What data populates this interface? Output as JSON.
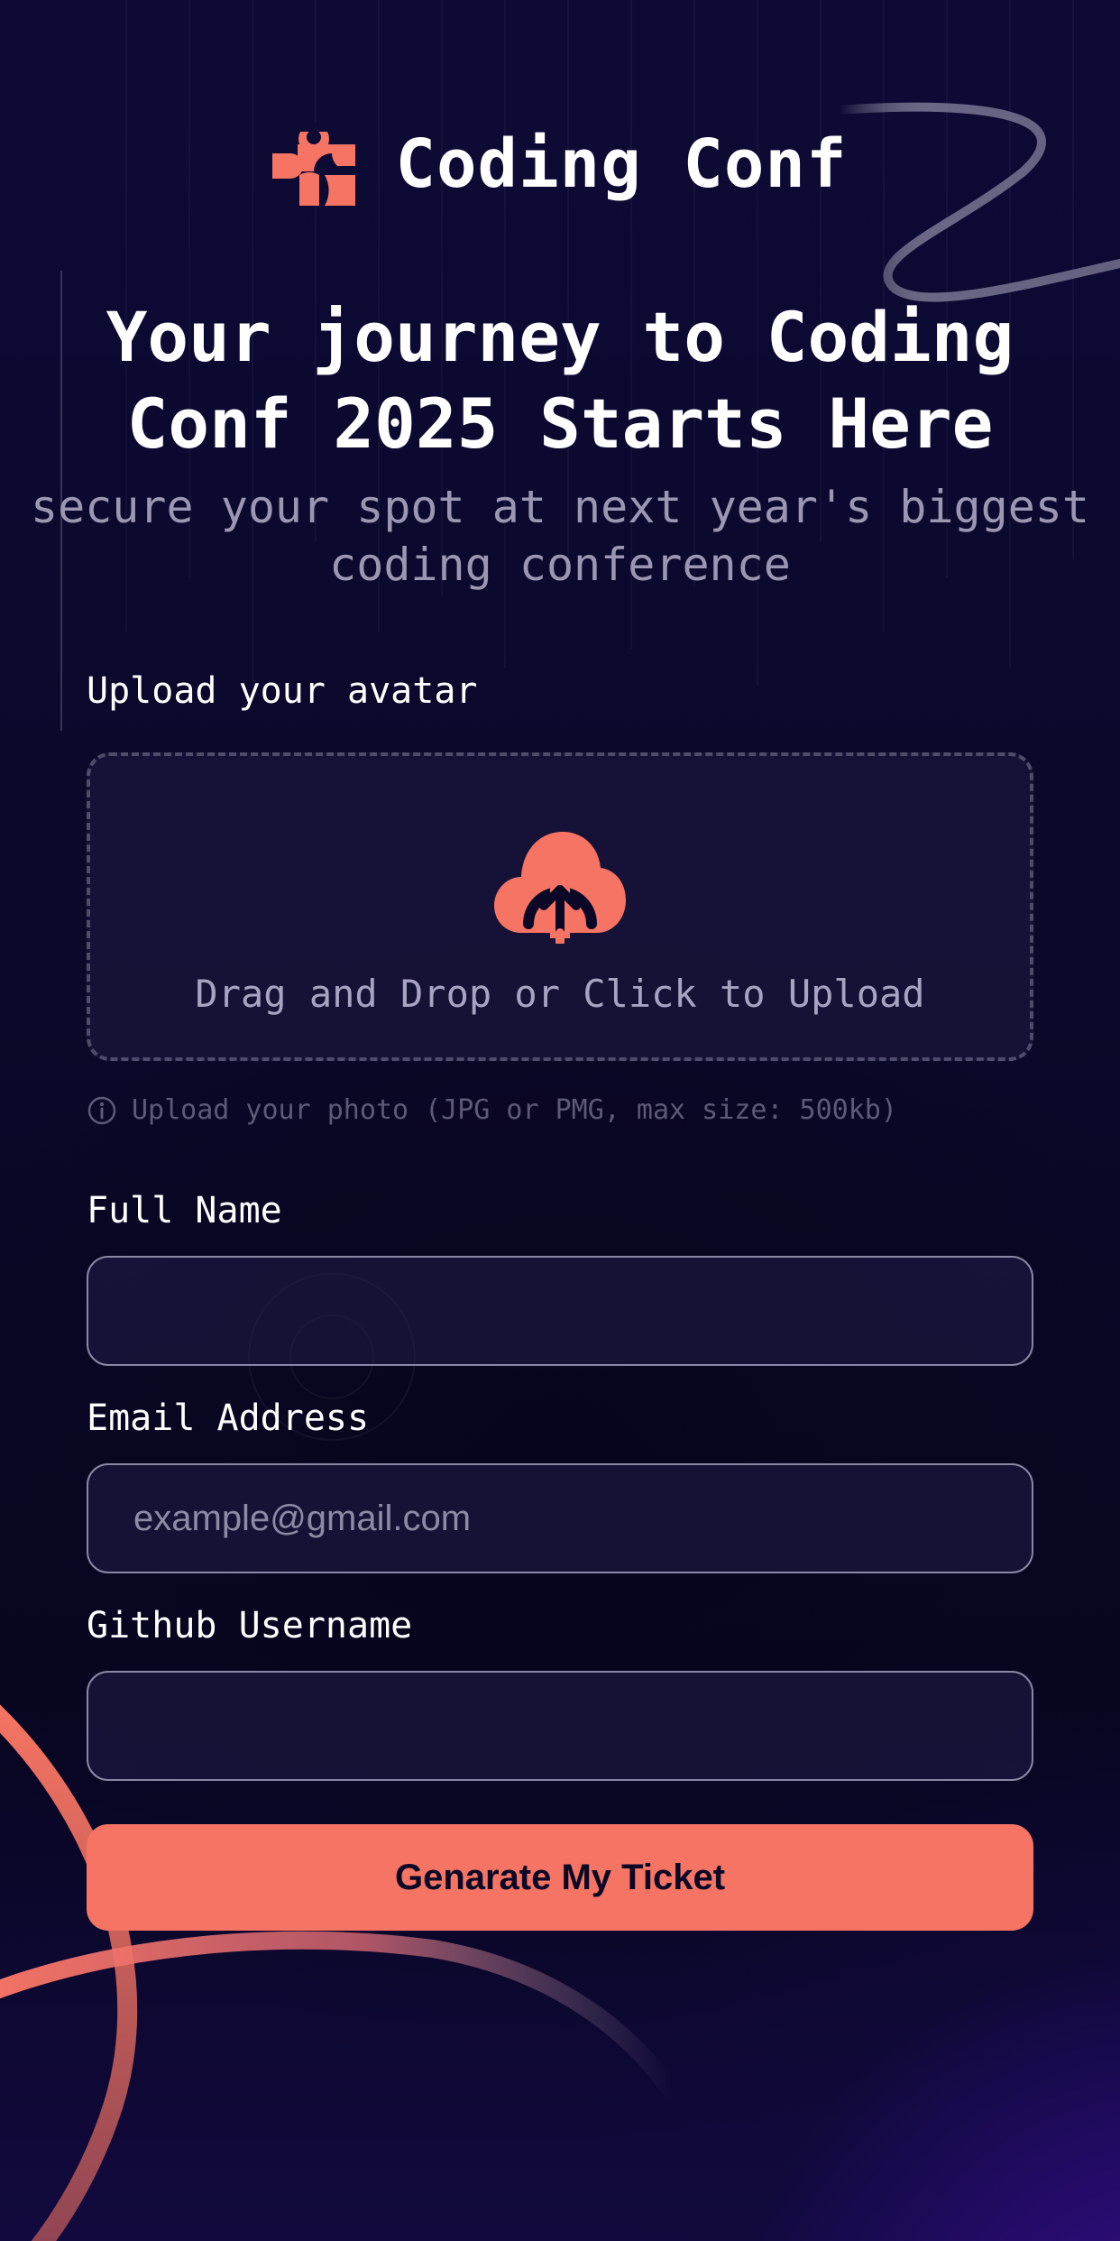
{
  "brand": {
    "name": "Coding Conf",
    "accent_color": "#f57463",
    "logo_icon": "coding-conf-logo-icon"
  },
  "hero": {
    "title": "Your journey to Coding Conf 2025 Starts Here",
    "subtitle": "secure your spot at next year's biggest coding conference"
  },
  "form": {
    "avatar": {
      "label": "Upload your avatar",
      "dropzone_text": "Drag and Drop or Click to Upload",
      "dropzone_icon": "cloud-upload-icon",
      "hint": "Upload your photo (JPG or PMG, max size: 500kb)",
      "hint_icon": "info-icon"
    },
    "full_name": {
      "label": "Full Name",
      "value": "",
      "placeholder": ""
    },
    "email": {
      "label": "Email Address",
      "value": "",
      "placeholder": "example@gmail.com"
    },
    "github": {
      "label": "Github Username",
      "value": "",
      "placeholder": ""
    },
    "submit_label": "Genarate My Ticket"
  }
}
